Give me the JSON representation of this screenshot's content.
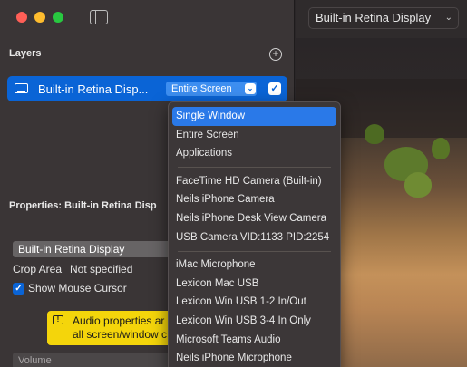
{
  "window": {
    "sidebar_toggle": "sidebar-toggle-icon"
  },
  "layers": {
    "title": "Layers",
    "add_symbol": "+",
    "selected_layer": {
      "label": "Built-in Retina Disp...",
      "mode": "Entire Screen",
      "enabled": true
    }
  },
  "properties": {
    "title": "Properties: Built-in Retina Disp",
    "display_field": "Built-in Retina Display",
    "crop_area_label": "Crop Area",
    "crop_area_value": "Not specified",
    "show_cursor_label": "Show Mouse Cursor",
    "show_cursor_checked": true,
    "warning_line1": "Audio properties ar",
    "warning_line2": "all screen/window c",
    "volume_label": "Volume"
  },
  "toolbar": {
    "display_select": "Built-in Retina Display"
  },
  "menu": {
    "groups": [
      [
        "Single Window",
        "Entire Screen",
        "Applications"
      ],
      [
        "FaceTime HD Camera (Built-in)",
        "Neils iPhone Camera",
        "Neils iPhone Desk View Camera",
        "USB Camera VID:1133 PID:2254"
      ],
      [
        "iMac Microphone",
        "Lexicon Mac USB",
        "Lexicon Win USB 1-2 In/Out",
        "Lexicon Win USB 3-4 In Only",
        "Microsoft Teams Audio",
        "Neils iPhone Microphone"
      ]
    ],
    "selected": "Single Window"
  },
  "colors": {
    "accent": "#0a64d6",
    "menu_highlight": "#2a79e8",
    "warning": "#f4d50b"
  }
}
